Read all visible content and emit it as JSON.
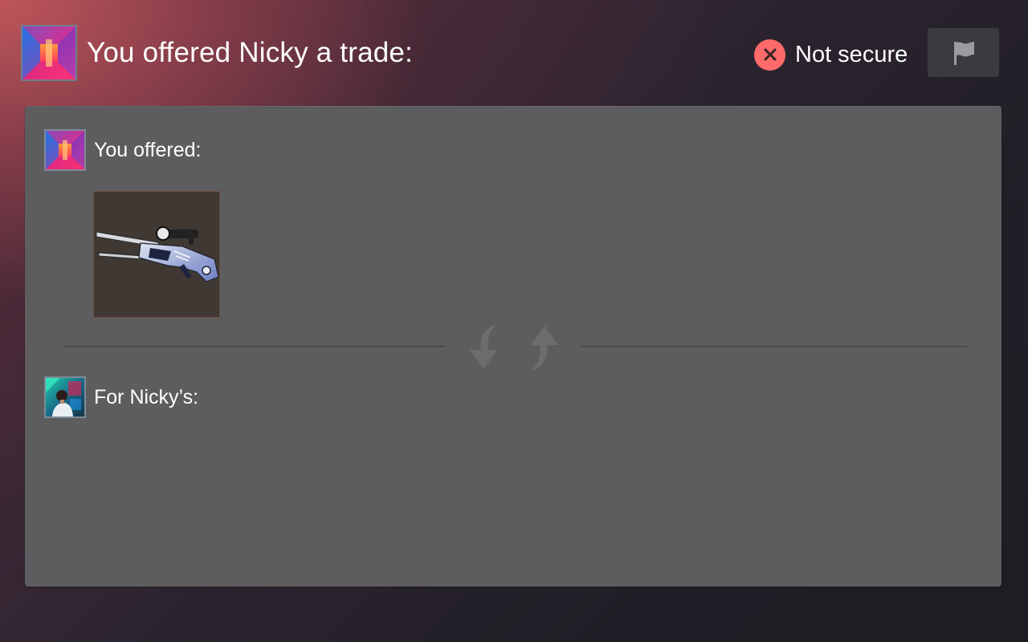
{
  "header": {
    "title": "You offered Nicky a trade:",
    "security_status": "Not secure",
    "security_icon": "close-icon",
    "flag_icon": "flag-icon",
    "status_color": "#ff6b6b"
  },
  "trade": {
    "offered_label": "You offered:",
    "offered_items": [
      {
        "icon": "sniper-rifle-icon",
        "kind": "weapon-skin"
      }
    ],
    "swap_icon": "swap-arrows-icon",
    "receiving_label": "For Nicky’s:",
    "receiving_items": []
  },
  "colors": {
    "panel": "#5d5d5f",
    "accent_danger": "#ff6b6b",
    "item_tile_bg": "#3f3833",
    "item_tile_border": "#6e4d41"
  }
}
